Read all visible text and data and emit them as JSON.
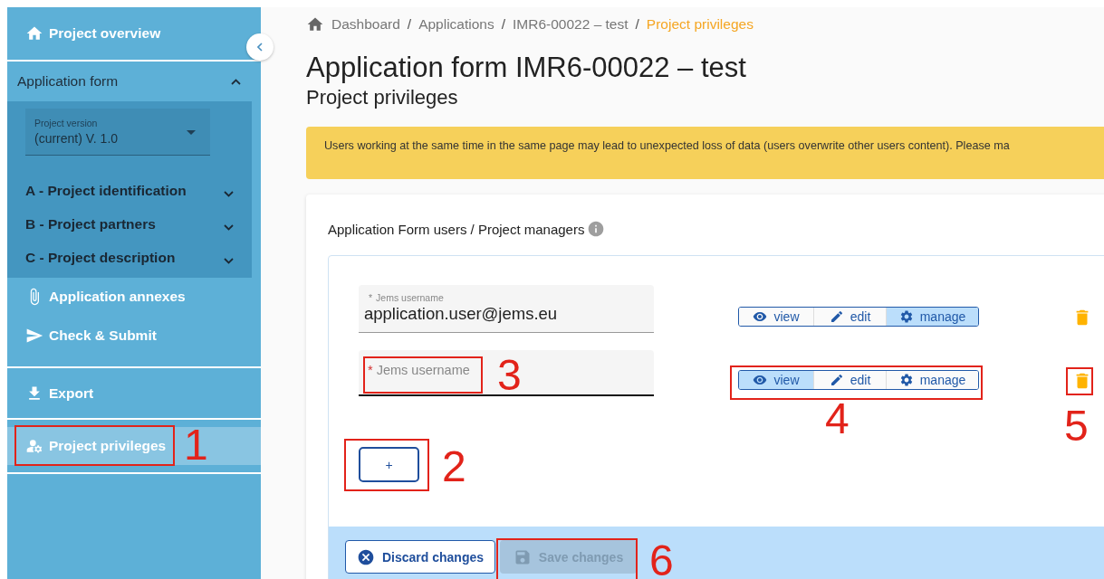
{
  "sidebar": {
    "groups": [
      {
        "items": [
          {
            "kind": "link",
            "label": "Project overview",
            "selected": false
          }
        ]
      },
      {
        "items": [
          {
            "kind": "section",
            "label": "Application form",
            "expanded": true,
            "version_field": {
              "label": "Project version",
              "value": "(current) V. 1.0"
            },
            "children": [
              {
                "label": "A - Project identification",
                "expanded": false
              },
              {
                "label": "B - Project partners",
                "expanded": false
              },
              {
                "label": "C - Project description",
                "expanded": false
              }
            ]
          },
          {
            "kind": "link",
            "label": "Application annexes",
            "selected": false
          },
          {
            "kind": "link",
            "label": "Check & Submit",
            "selected": false
          }
        ]
      },
      {
        "items": [
          {
            "kind": "link",
            "label": "Export",
            "selected": false
          }
        ]
      },
      {
        "items": [
          {
            "kind": "link",
            "label": "Project privileges",
            "selected": true
          }
        ]
      }
    ]
  },
  "breadcrumb": [
    {
      "label": "Dashboard",
      "current": false
    },
    {
      "label": "Applications",
      "current": false
    },
    {
      "label": "IMR6-00022 – test",
      "current": false
    },
    {
      "label": "Project privileges",
      "current": true
    }
  ],
  "breadcrumb_separator": "/",
  "title": "Application form IMR6-00022 – test",
  "subtitle": "Project privileges",
  "warning": "Users working at the same time in the same page may lead to unexpected loss of data (users overwrite other users content). Please ma",
  "card": {
    "heading": "Application Form users / Project managers",
    "rows": [
      {
        "username": {
          "required_mark": "*",
          "label": "Jems username",
          "value": "application.user@jems.eu",
          "focused": false
        },
        "permissions": [
          {
            "label": "view",
            "selected": false
          },
          {
            "label": "edit",
            "selected": false
          },
          {
            "label": "manage",
            "selected": true
          }
        ]
      },
      {
        "username": {
          "required_mark": "*",
          "label": "Jems username",
          "focused": true
        },
        "permissions": [
          {
            "label": "view",
            "selected": true
          },
          {
            "label": "edit",
            "selected": false
          },
          {
            "label": "manage",
            "selected": false
          }
        ]
      }
    ],
    "add_button": "+",
    "discard_button": {
      "label": "Discard changes",
      "disabled": false
    },
    "save_button": {
      "label": "Save changes",
      "disabled": true
    }
  },
  "annotations": [
    {
      "label": "1"
    },
    {
      "label": "2"
    },
    {
      "label": "3"
    },
    {
      "label": "4"
    },
    {
      "label": "5"
    },
    {
      "label": "6"
    }
  ]
}
